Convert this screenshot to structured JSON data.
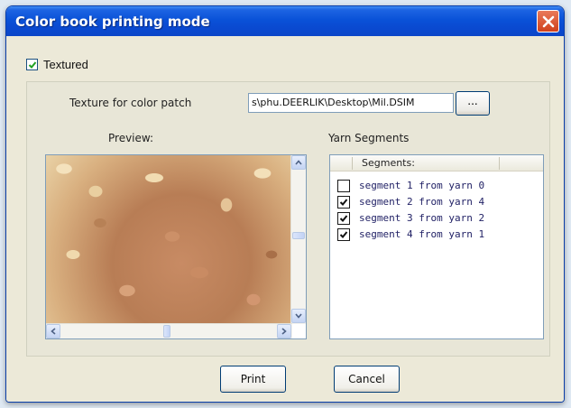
{
  "window": {
    "title": "Color book printing mode",
    "close_icon": "close-icon"
  },
  "textured": {
    "label": "Textured",
    "checked": true
  },
  "texture": {
    "label": "Texture for color patch",
    "path_value": "s\\phu.DEERLIK\\Desktop\\Mil.DSIM",
    "browse_label": "..."
  },
  "preview": {
    "label": "Preview:"
  },
  "yarn": {
    "label": "Yarn Segments",
    "column_header": "Segments:",
    "items": [
      {
        "label": "segment 1 from yarn 0",
        "checked": false
      },
      {
        "label": "segment 2 from yarn 4",
        "checked": true
      },
      {
        "label": "segment 3 from yarn 2",
        "checked": true
      },
      {
        "label": "segment 4 from yarn 1",
        "checked": true
      }
    ]
  },
  "buttons": {
    "print": "Print",
    "cancel": "Cancel"
  }
}
